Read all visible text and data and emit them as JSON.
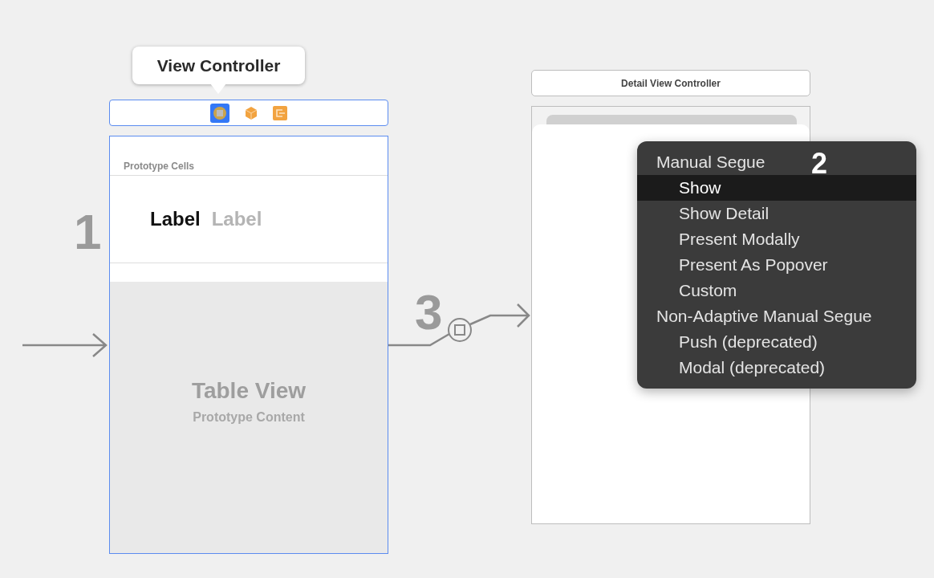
{
  "scenes": [
    {
      "title": "View Controller",
      "section_header": "Prototype Cells",
      "cell_labels": [
        "Label",
        "Label"
      ],
      "table_title": "Table View",
      "table_subtitle": "Prototype Content",
      "step": "1"
    },
    {
      "title": "Detail View Controller"
    }
  ],
  "segue": {
    "step": "3"
  },
  "menu": {
    "step": "2",
    "items": [
      {
        "kind": "header",
        "label": "Manual Segue",
        "selected": false
      },
      {
        "kind": "item",
        "label": "Show",
        "selected": true
      },
      {
        "kind": "item",
        "label": "Show Detail",
        "selected": false
      },
      {
        "kind": "item",
        "label": "Present Modally",
        "selected": false
      },
      {
        "kind": "item",
        "label": "Present As Popover",
        "selected": false
      },
      {
        "kind": "item",
        "label": "Custom",
        "selected": false
      },
      {
        "kind": "header",
        "label": "Non-Adaptive Manual Segue",
        "selected": false
      },
      {
        "kind": "item",
        "label": "Push (deprecated)",
        "selected": false
      },
      {
        "kind": "item",
        "label": "Modal (deprecated)",
        "selected": false
      }
    ]
  }
}
